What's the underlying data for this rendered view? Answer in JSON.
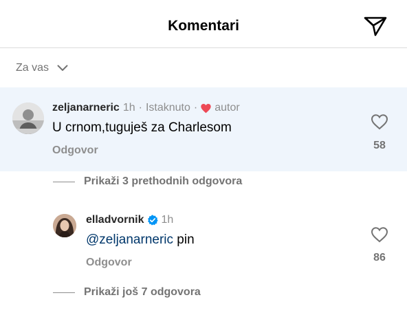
{
  "header": {
    "title": "Komentari",
    "send_icon": "paper-plane-icon"
  },
  "filter": {
    "label": "Za vas",
    "icon": "chevron-down-icon"
  },
  "comments": [
    {
      "username": "zeljanarneric",
      "time": "1h",
      "separator": "·",
      "tag": "Istaknuto",
      "author_label": "autor",
      "author_heart_color": "#ed4956",
      "text": "U crnom,tuguješ za Charlesom",
      "reply_label": "Odgovor",
      "likes": "58",
      "highlight_color": "#eff5fc"
    }
  ],
  "show_previous": "Prikaži 3 prethodnih odgovora",
  "replies": [
    {
      "username": "elladvornik",
      "verified": true,
      "verified_color": "#0095f6",
      "time": "1h",
      "mention": "@zeljanarneric",
      "text": " pin",
      "reply_label": "Odgovor",
      "likes": "86"
    }
  ],
  "show_more": "Prikaži još 7 odgovora"
}
